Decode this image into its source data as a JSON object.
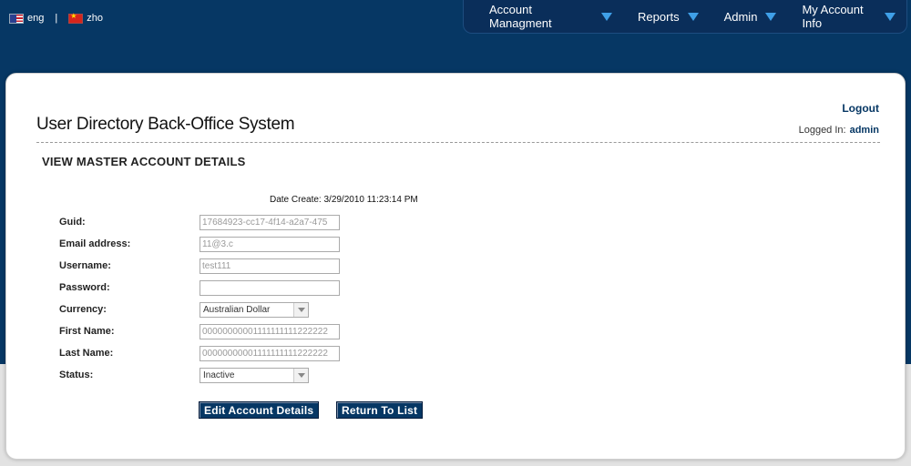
{
  "languages": [
    {
      "label": "eng",
      "flag": "us-flag-icon"
    },
    {
      "label": "zho",
      "flag": "china-flag-icon"
    }
  ],
  "language_separator": "|",
  "nav": {
    "items": [
      {
        "label": "Account Managment"
      },
      {
        "label": "Reports"
      },
      {
        "label": "Admin"
      },
      {
        "label": "My Account Info"
      }
    ],
    "arrow_color": "#3fa0e8"
  },
  "header": {
    "system_title": "User Directory Back-Office System",
    "logout_label": "Logout",
    "logged_in_label": "Logged In:",
    "username": "admin"
  },
  "section_title": "VIEW MASTER ACCOUNT DETAILS",
  "date_create": "Date Create: 3/29/2010 11:23:14 PM",
  "form": {
    "guid": {
      "label": "Guid:",
      "value": "17684923-cc17-4f14-a2a7-475"
    },
    "email": {
      "label": "Email address:",
      "value": "11@3.c"
    },
    "username": {
      "label": "Username:",
      "value": "test111"
    },
    "password": {
      "label": "Password:",
      "value": ""
    },
    "currency": {
      "label": "Currency:",
      "value": "Australian Dollar"
    },
    "first_name": {
      "label": "First Name:",
      "value": "00000000001111111111222222"
    },
    "last_name": {
      "label": "Last Name:",
      "value": "00000000001111111111222222"
    },
    "status": {
      "label": "Status:",
      "value": "Inactive"
    }
  },
  "buttons": {
    "edit_label": "Edit Account Details",
    "return_label": "Return To List"
  },
  "colors": {
    "brand_navy": "#063764",
    "background_band": "#063764"
  }
}
